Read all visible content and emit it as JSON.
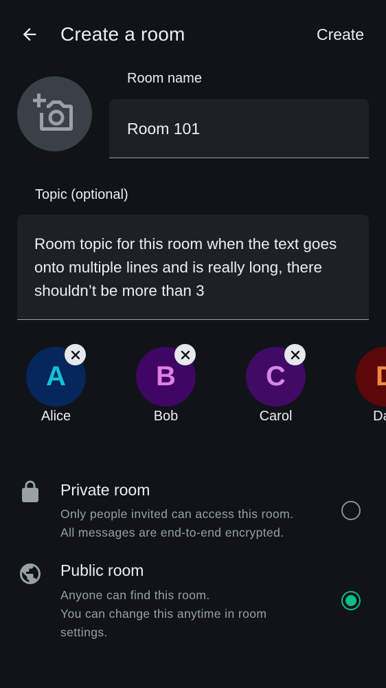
{
  "topbar": {
    "title": "Create a room",
    "create_label": "Create",
    "back_icon": "arrow-left-icon"
  },
  "avatar_picker": {
    "icon": "add-photo-icon"
  },
  "room_name": {
    "label": "Room name",
    "value": "Room 101"
  },
  "topic": {
    "label": "Topic (optional)",
    "value": "Room topic for this room when the text goes onto multiple lines and is really long, there shouldn’t be more than 3"
  },
  "selected_users": [
    {
      "initial": "A",
      "name": "Alice",
      "bg": "#05275c",
      "fg": "#15c0d6"
    },
    {
      "initial": "B",
      "name": "Bob",
      "bg": "#3f0663",
      "fg": "#e07fe3"
    },
    {
      "initial": "C",
      "name": "Carol",
      "bg": "#410a65",
      "fg": "#d686e8"
    },
    {
      "initial": "D",
      "name": "Dan",
      "bg": "#5c0808",
      "fg": "#f08a3c"
    }
  ],
  "room_types": {
    "private": {
      "title": "Private room",
      "desc_line1": "Only people invited can access this room.",
      "desc_line2": "All messages are end-to-end encrypted.",
      "icon": "lock-icon",
      "selected": false
    },
    "public": {
      "title": "Public room",
      "desc_line1": "Anyone can find this room.",
      "desc_line2": "You can change this anytime in room",
      "desc_line3": "settings.",
      "icon": "globe-icon",
      "selected": true
    }
  },
  "colors": {
    "background": "#101317",
    "field_background": "#1d2125",
    "accent": "#0dbd8b",
    "secondary_text": "#9aa0a8"
  }
}
